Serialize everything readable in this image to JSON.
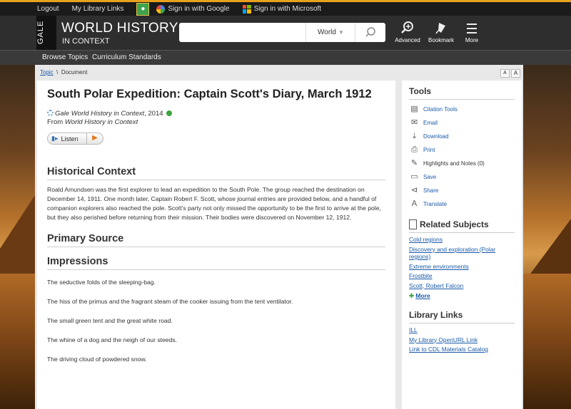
{
  "topbar": {
    "logout": "Logout",
    "my_library_links": "My Library Links",
    "google": "Sign in with Google",
    "microsoft": "Sign in with Microsoft"
  },
  "header": {
    "gale": "GALE",
    "title": "WORLD HISTORY",
    "subtitle": "IN CONTEXT",
    "search_placeholder": "",
    "scope": "World",
    "advanced": "Advanced",
    "bookmark": "Bookmark",
    "more": "More"
  },
  "nav": {
    "browse_topics": "Browse Topics",
    "curriculum_standards": "Curriculum Standards"
  },
  "breadcrumb": {
    "topic": "Topic",
    "sep": "\\",
    "current": "Document"
  },
  "article": {
    "title": "South Polar Expedition: Captain Scott's Diary, March 1912",
    "source_italic": "Gale World History in Context",
    "source_year": ", 2014",
    "from_prefix": "From ",
    "from_italic": "World History in Context",
    "listen": "Listen",
    "h_context": "Historical Context",
    "context_text": "Roald Amundsen was the first explorer to lead an expedition to the South Pole. The group reached the destination on December 14, 1911. One month later, Captain Robert F. Scott, whose journal entries are provided below, and a handful of companion explorers also reached the pole. Scott's party not only missed the opportunity to be the first to arrive at the pole, but they also perished before returning from their mission. Their bodies were discovered on November 12, 1912.",
    "h_primary": "Primary Source",
    "h_impressions": "Impressions",
    "impressions": [
      "The seductive folds of the sleeping-bag.",
      "The hiss of the primus and the fragrant steam of the cooker issuing from the tent ventilator.",
      "The small green tent and the great white road.",
      "The whine of a dog and the neigh of our steeds.",
      "The driving cloud of powdered snow."
    ]
  },
  "sidebar": {
    "tools_title": "Tools",
    "tools": [
      {
        "label": "Citation Tools",
        "icon": "citation-icon"
      },
      {
        "label": "Email",
        "icon": "email-icon"
      },
      {
        "label": "Download",
        "icon": "download-icon"
      },
      {
        "label": "Print",
        "icon": "print-icon"
      },
      {
        "label": "Highlights and Notes (0)",
        "icon": "highlight-icon"
      },
      {
        "label": "Save",
        "icon": "folder-icon"
      },
      {
        "label": "Share",
        "icon": "share-icon"
      },
      {
        "label": "Translate",
        "icon": "translate-icon"
      }
    ],
    "related_title": "Related Subjects",
    "related": [
      "Cold regions",
      "Discovery and exploration (Polar regions)",
      "Extreme environments",
      "Frostbite",
      "Scott, Robert Falcon"
    ],
    "more": "More",
    "library_title": "Library Links",
    "library": [
      "ILL",
      "My Library OpenURL Link",
      "Link to CDL Materials Catalog"
    ]
  },
  "colors": {
    "accent": "#e7a11c",
    "link": "#1a5aa8",
    "header_bg": "#2e2e2e"
  }
}
